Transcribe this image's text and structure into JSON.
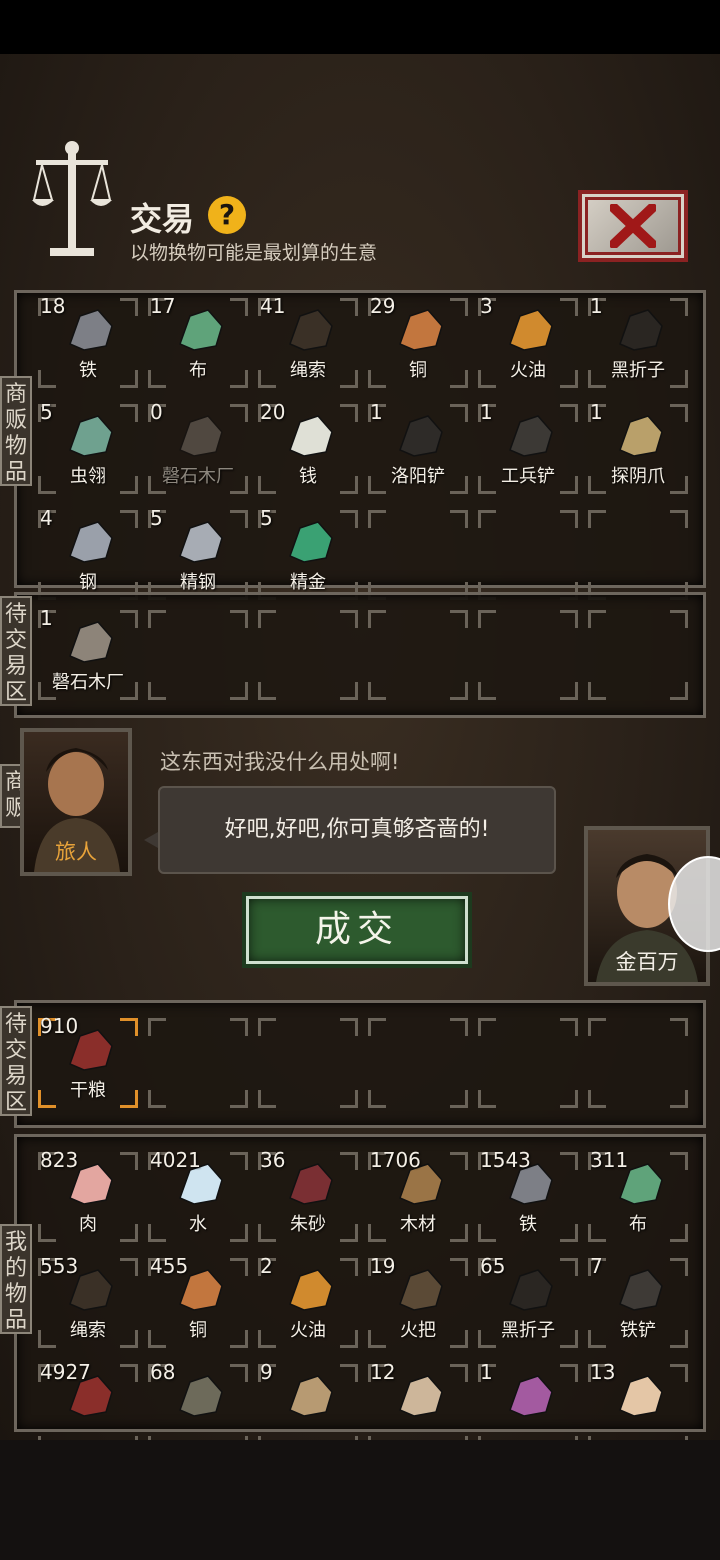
{
  "header": {
    "title": "交易",
    "help_label": "?",
    "subtitle": "以物换物可能是最划算的生意"
  },
  "merchant_tab": "商贩物品",
  "merchant_items": [
    {
      "count": "18",
      "name": "铁",
      "icon": "iron-ore-icon"
    },
    {
      "count": "17",
      "name": "布",
      "icon": "cloth-icon"
    },
    {
      "count": "41",
      "name": "绳索",
      "icon": "rope-icon"
    },
    {
      "count": "29",
      "name": "铜",
      "icon": "copper-ore-icon"
    },
    {
      "count": "3",
      "name": "火油",
      "icon": "oil-jar-icon"
    },
    {
      "count": "1",
      "name": "黑折子",
      "icon": "black-fold-icon"
    },
    {
      "count": "5",
      "name": "虫翎",
      "icon": "insect-wing-icon"
    },
    {
      "count": "0",
      "name": "磬石木厂",
      "icon": "blueprint-icon",
      "dim": true
    },
    {
      "count": "20",
      "name": "钱",
      "icon": "money-icon"
    },
    {
      "count": "1",
      "name": "洛阳铲",
      "icon": "luoyang-shovel-icon"
    },
    {
      "count": "1",
      "name": "工兵铲",
      "icon": "engineer-shovel-icon"
    },
    {
      "count": "1",
      "name": "探阴爪",
      "icon": "probe-claw-icon"
    },
    {
      "count": "4",
      "name": "钢",
      "icon": "steel-icon"
    },
    {
      "count": "5",
      "name": "精钢",
      "icon": "fine-steel-icon"
    },
    {
      "count": "5",
      "name": "精金",
      "icon": "fine-gold-icon"
    }
  ],
  "merchant_pending_tab": "待交易区",
  "merchant_pending": [
    {
      "count": "1",
      "name": "磬石木厂",
      "icon": "blueprint-icon"
    }
  ],
  "dialogue": {
    "npc_tab": "商贩",
    "npc_name": "旅人",
    "npc_line": "这东西对我没什么用处啊!",
    "player_line": "好吧,好吧,你可真够吝啬的!",
    "player_name": "金百万",
    "deal_button": "成交"
  },
  "player_pending_tab": "待交易区",
  "player_pending": [
    {
      "count": "910",
      "name": "干粮",
      "icon": "jerky-icon"
    }
  ],
  "player_tab": "我的物品",
  "player_items": [
    {
      "count": "823",
      "name": "肉",
      "icon": "meat-icon"
    },
    {
      "count": "4021",
      "name": "水",
      "icon": "water-drop-icon"
    },
    {
      "count": "36",
      "name": "朱砂",
      "icon": "cinnabar-icon"
    },
    {
      "count": "1706",
      "name": "木材",
      "icon": "wood-plank-icon"
    },
    {
      "count": "1543",
      "name": "铁",
      "icon": "iron-ore-icon"
    },
    {
      "count": "311",
      "name": "布",
      "icon": "cloth-icon"
    },
    {
      "count": "553",
      "name": "绳索",
      "icon": "rope-icon"
    },
    {
      "count": "455",
      "name": "铜",
      "icon": "copper-ore-icon"
    },
    {
      "count": "2",
      "name": "火油",
      "icon": "oil-jar-icon"
    },
    {
      "count": "19",
      "name": "火把",
      "icon": "torch-icon"
    },
    {
      "count": "65",
      "name": "黑折子",
      "icon": "black-fold-icon"
    },
    {
      "count": "7",
      "name": "铁铲",
      "icon": "iron-shovel-icon"
    },
    {
      "count": "4927",
      "name": "",
      "icon": "jerky-icon"
    },
    {
      "count": "68",
      "name": "",
      "icon": "gourd-icon"
    },
    {
      "count": "9",
      "name": "",
      "icon": "pelt-icon"
    },
    {
      "count": "12",
      "name": "",
      "icon": "fang-icon"
    },
    {
      "count": "1",
      "name": "",
      "icon": "pearl-icon"
    },
    {
      "count": "13",
      "name": "",
      "icon": "bone-icon"
    }
  ]
}
